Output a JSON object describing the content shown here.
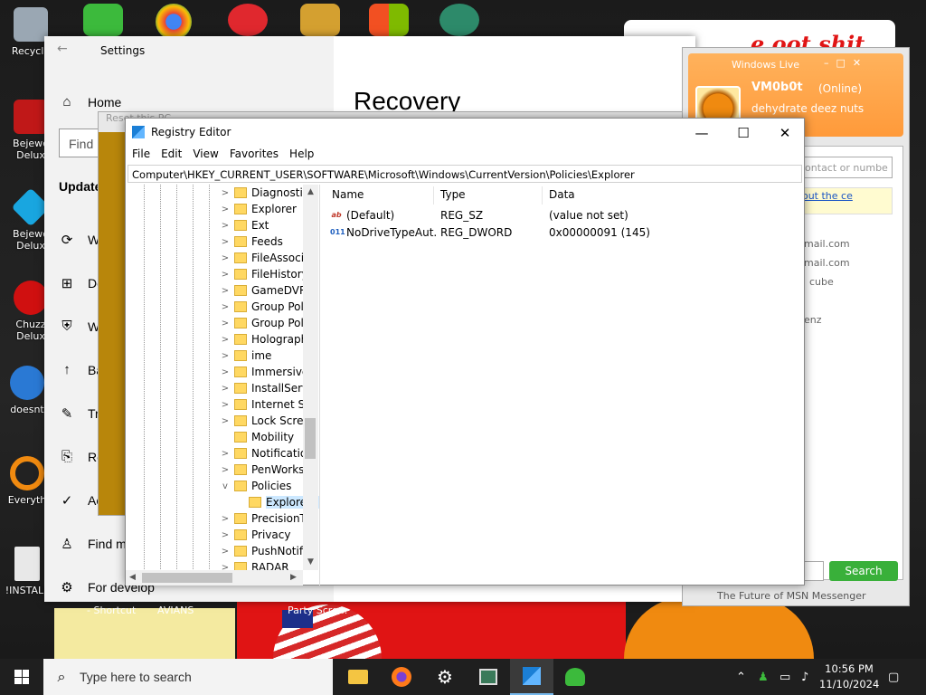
{
  "desktop": {
    "left_icons": [
      {
        "label": "Recycle",
        "icon": "recycle-bin-icon",
        "color": "#9aa7b3"
      },
      {
        "label": "Bejewe Delux",
        "icon": "bejeweled-icon",
        "color": "#c01818"
      },
      {
        "label": "Bejewe Delux",
        "icon": "bejeweled-icon",
        "color": "#19a6e0"
      },
      {
        "label": "Chuzz Delux",
        "icon": "chuzzle-icon",
        "color": "#d01010"
      },
      {
        "label": "doesnt",
        "icon": "thunderbird-icon",
        "color": "#2a79d4"
      },
      {
        "label": "Everyth",
        "icon": "everything-search-icon",
        "color": "#f08a10"
      },
      {
        "label": "!INSTALL",
        "icon": "document-icon",
        "color": "#e8e8e8"
      }
    ],
    "bottom_labels": [
      "- Shortcut",
      "AVIANS",
      "Party Scre..."
    ],
    "overlay_text": "e oot shit"
  },
  "settings": {
    "title": "Settings",
    "find_placeholder": "Find",
    "section": "Update",
    "page_heading": "Recovery",
    "nav": [
      {
        "label": "Home",
        "icon": "home-icon"
      },
      {
        "label": "W",
        "icon": "sync-icon"
      },
      {
        "label": "De",
        "icon": "delivery-optimization-icon"
      },
      {
        "label": "W",
        "icon": "shield-icon"
      },
      {
        "label": "Ba",
        "icon": "backup-icon"
      },
      {
        "label": "Tr",
        "icon": "troubleshoot-icon"
      },
      {
        "label": "Re",
        "icon": "recovery-icon"
      },
      {
        "label": "Ac",
        "icon": "activation-icon"
      },
      {
        "label": "Find m",
        "icon": "find-device-icon"
      },
      {
        "label": "For develop",
        "icon": "developer-icon"
      }
    ]
  },
  "reset_dialog": {
    "title": "Reset this PC"
  },
  "msn": {
    "app_name": "Windows Live",
    "username": "VM0b0t",
    "status": "(Online)",
    "personal_message": "dehydrate deez nuts",
    "search_placeholder": "contact or numbe",
    "notice": "bout the ce",
    "contacts": [
      "mail.com",
      "mail.com",
      "cube",
      "enz"
    ],
    "search_button": "Search",
    "footer": "The Future of MSN Messenger"
  },
  "regedit": {
    "title": "Registry Editor",
    "menu": [
      "File",
      "Edit",
      "View",
      "Favorites",
      "Help"
    ],
    "address": "Computer\\HKEY_CURRENT_USER\\SOFTWARE\\Microsoft\\Windows\\CurrentVersion\\Policies\\Explorer",
    "tree": [
      {
        "label": "Diagnostics",
        "expand": ">",
        "selected": false,
        "child": false
      },
      {
        "label": "Explorer",
        "expand": ">",
        "selected": false,
        "child": false
      },
      {
        "label": "Ext",
        "expand": ">",
        "selected": false,
        "child": false
      },
      {
        "label": "Feeds",
        "expand": ">",
        "selected": false,
        "child": false
      },
      {
        "label": "FileAssociati",
        "expand": ">",
        "selected": false,
        "child": false
      },
      {
        "label": "FileHistory",
        "expand": ">",
        "selected": false,
        "child": false
      },
      {
        "label": "GameDVR",
        "expand": ">",
        "selected": false,
        "child": false
      },
      {
        "label": "Group Polic",
        "expand": ">",
        "selected": false,
        "child": false
      },
      {
        "label": "Group Polic",
        "expand": ">",
        "selected": false,
        "child": false
      },
      {
        "label": "Holographi",
        "expand": ">",
        "selected": false,
        "child": false
      },
      {
        "label": "ime",
        "expand": ">",
        "selected": false,
        "child": false
      },
      {
        "label": "ImmersiveS",
        "expand": ">",
        "selected": false,
        "child": false
      },
      {
        "label": "InstallServic",
        "expand": ">",
        "selected": false,
        "child": false
      },
      {
        "label": "Internet Set",
        "expand": ">",
        "selected": false,
        "child": false
      },
      {
        "label": "Lock Screen",
        "expand": ">",
        "selected": false,
        "child": false
      },
      {
        "label": "Mobility",
        "expand": "",
        "selected": false,
        "child": false
      },
      {
        "label": "Notification",
        "expand": ">",
        "selected": false,
        "child": false
      },
      {
        "label": "PenWorksp",
        "expand": ">",
        "selected": false,
        "child": false
      },
      {
        "label": "Policies",
        "expand": "v",
        "selected": false,
        "child": false
      },
      {
        "label": "Explorer",
        "expand": "",
        "selected": true,
        "child": true
      },
      {
        "label": "PrecisionTo",
        "expand": ">",
        "selected": false,
        "child": false
      },
      {
        "label": "Privacy",
        "expand": ">",
        "selected": false,
        "child": false
      },
      {
        "label": "PushNotific",
        "expand": ">",
        "selected": false,
        "child": false
      },
      {
        "label": "RADAR",
        "expand": ">",
        "selected": false,
        "child": false
      }
    ],
    "columns": [
      "Name",
      "Type",
      "Data"
    ],
    "values": [
      {
        "icon": "ab",
        "name": "(Default)",
        "type": "REG_SZ",
        "data": "(value not set)"
      },
      {
        "icon": "011",
        "name": "NoDriveTypeAut...",
        "type": "REG_DWORD",
        "data": "0x00000091 (145)"
      }
    ]
  },
  "taskbar": {
    "search_placeholder": "Type here to search",
    "apps": [
      "file-explorer-icon",
      "firefox-icon",
      "settings-gear-icon",
      "reset-pc-icon",
      "regedit-icon",
      "msn-messenger-icon"
    ],
    "time": "10:56 PM",
    "date": "11/10/2024"
  }
}
